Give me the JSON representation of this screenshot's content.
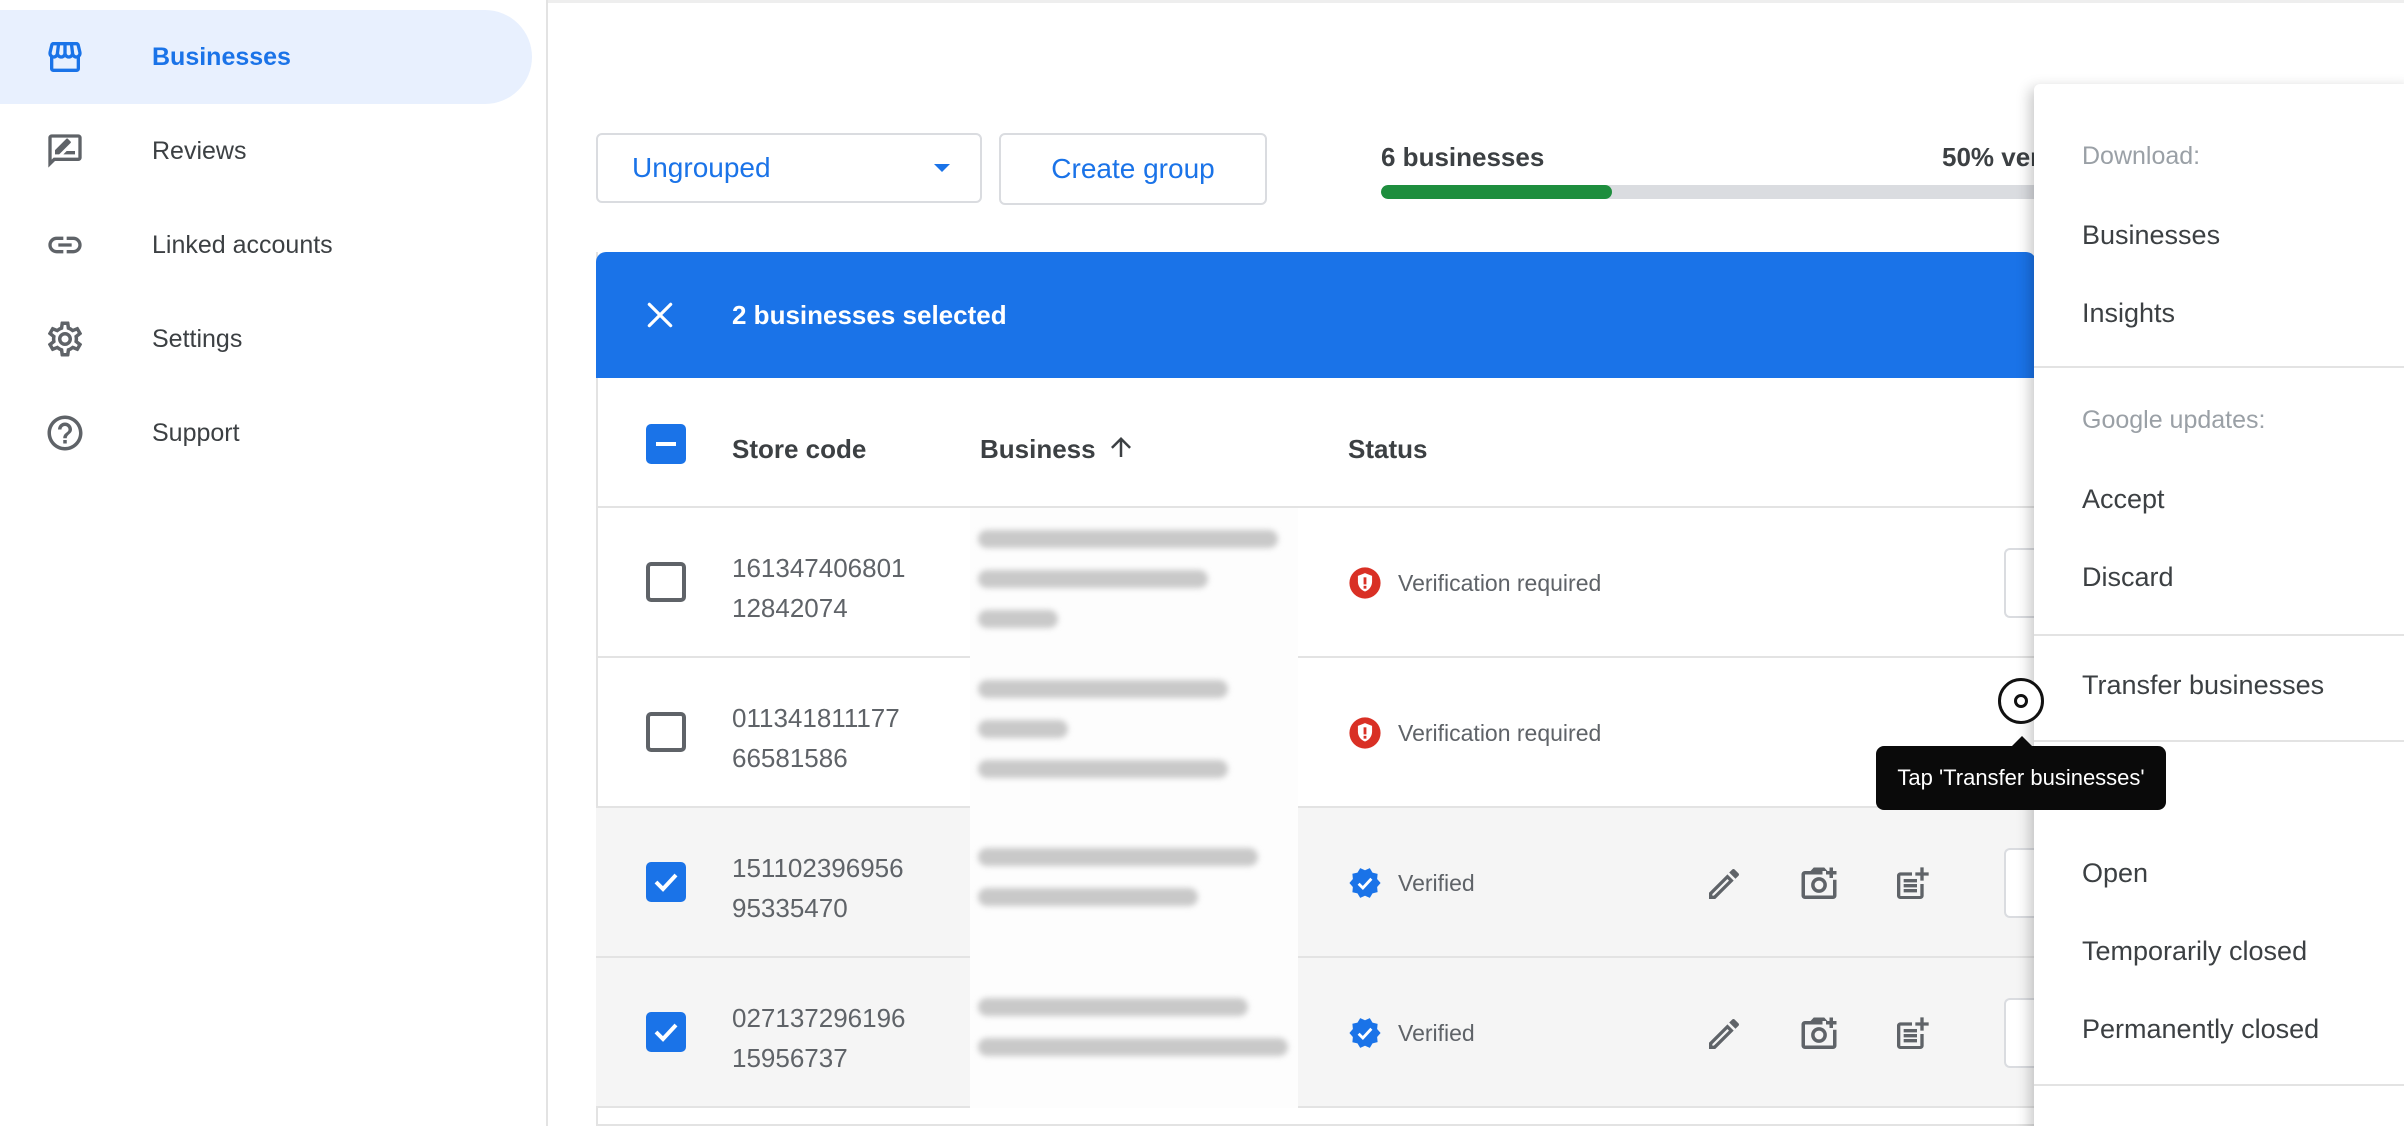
{
  "sidebar": {
    "items": [
      {
        "label": "Businesses",
        "icon": "storefront-icon",
        "active": true
      },
      {
        "label": "Reviews",
        "icon": "rate-review-icon",
        "active": false
      },
      {
        "label": "Linked accounts",
        "icon": "link-icon",
        "active": false
      },
      {
        "label": "Settings",
        "icon": "gear-icon",
        "active": false
      },
      {
        "label": "Support",
        "icon": "help-circle-icon",
        "active": false
      }
    ]
  },
  "toolbar": {
    "group_select": "Ungrouped",
    "create_group_label": "Create group",
    "progress_label": "6 businesses",
    "progress_pct_label": "50% ver",
    "progress_fraction": 0.35
  },
  "selection_bar": {
    "text": "2 businesses selected"
  },
  "table": {
    "headers": {
      "store_code": "Store code",
      "business": "Business",
      "status": "Status"
    },
    "sort": "ascending",
    "rows": [
      {
        "store_code_1": "161347406801",
        "store_code_2": "12842074",
        "status": "Verification required",
        "status_type": "warning",
        "checked": false
      },
      {
        "store_code_1": "011341811177",
        "store_code_2": "66581586",
        "status": "Verification required",
        "status_type": "warning",
        "checked": false
      },
      {
        "store_code_1": "151102396956",
        "store_code_2": "95335470",
        "status": "Verified",
        "status_type": "verified",
        "checked": true
      },
      {
        "store_code_1": "027137296196",
        "store_code_2": "15956737",
        "status": "Verified",
        "status_type": "verified",
        "checked": true
      }
    ]
  },
  "menu": {
    "download_heading": "Download:",
    "download_businesses": "Businesses",
    "download_insights": "Insights",
    "google_updates_heading": "Google updates:",
    "accept": "Accept",
    "discard": "Discard",
    "transfer": "Transfer businesses",
    "open": "Open",
    "temporarily_closed": "Temporarily closed",
    "permanently_closed": "Permanently closed"
  },
  "tooltip": {
    "text": "Tap 'Transfer businesses'"
  },
  "colors": {
    "accent": "#1a73e8",
    "progress": "#1e8e3e",
    "warning": "#d93025"
  }
}
